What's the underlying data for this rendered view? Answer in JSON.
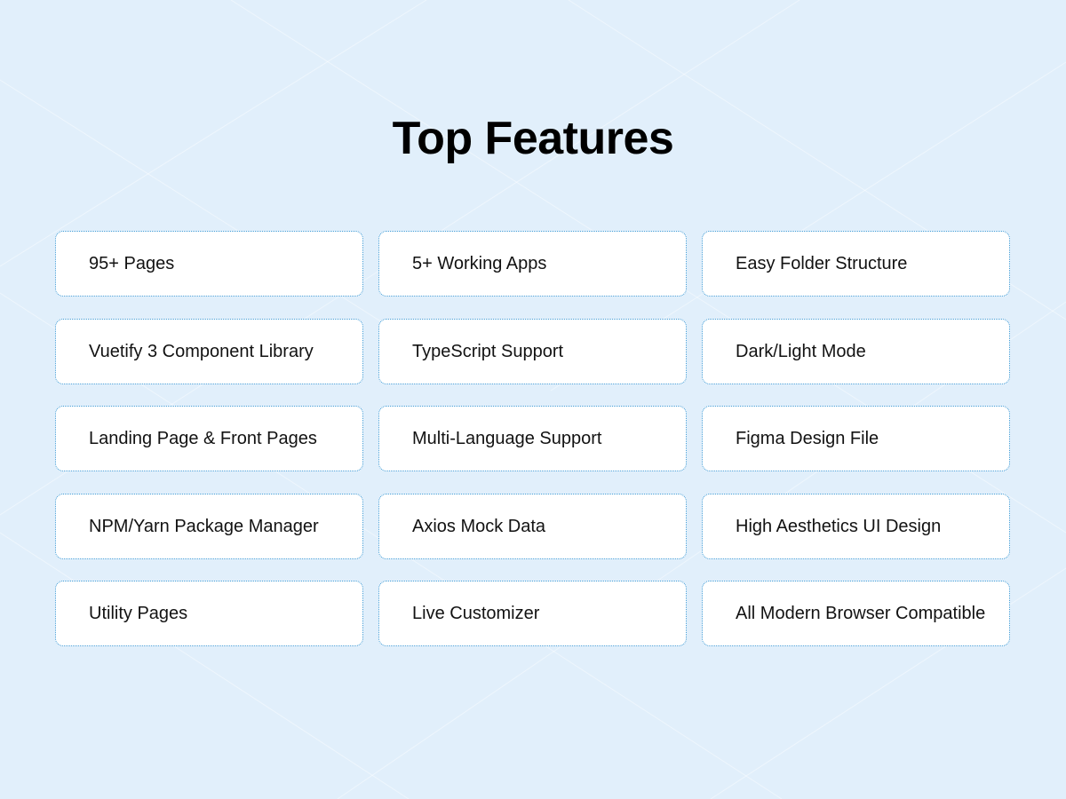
{
  "title": "Top Features",
  "colors": {
    "background": "#e1effb",
    "card_background": "#ffffff",
    "card_border": "#3d9ad6",
    "text": "#121212"
  },
  "features": [
    "95+ Pages",
    "5+ Working Apps",
    "Easy Folder Structure",
    "Vuetify 3 Component Library",
    "TypeScript Support",
    "Dark/Light Mode",
    "Landing Page & Front Pages",
    "Multi-Language Support",
    "Figma Design File",
    "NPM/Yarn Package Manager",
    "Axios Mock Data",
    "High Aesthetics UI Design",
    "Utility Pages",
    "Live Customizer",
    "All Modern Browser Compatible"
  ]
}
